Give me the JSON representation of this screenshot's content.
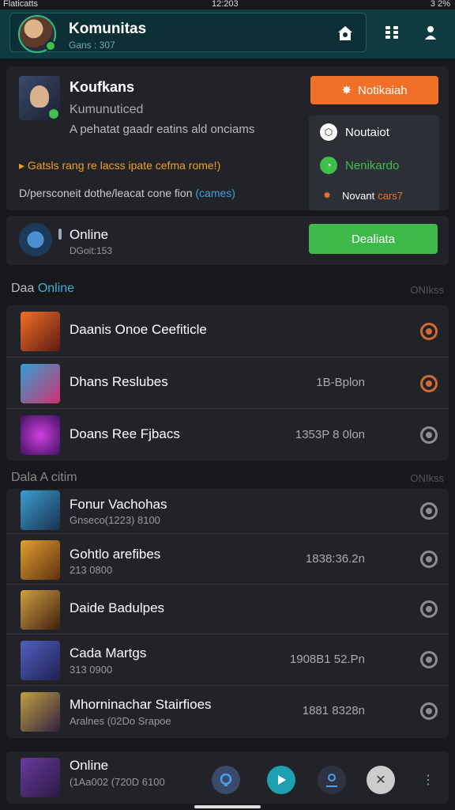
{
  "status_bar": {
    "carrier": "Flaticatts",
    "time": "12:203",
    "battery": "3 2%"
  },
  "header": {
    "title": "Komunitas",
    "subtitle": "Gans : 307"
  },
  "notification": {
    "title": "Koufkans",
    "subtitle": "Kumunuticed",
    "description": "A pehatat gaadr eatins ald onciams",
    "highlight_line": "Gatsls rang re lacss ipate cefma rome!)",
    "info_line": "D/persconeit dothe/leacat cone fion",
    "info_link": "(cames)",
    "action_button": "Notikaiah",
    "menu": [
      {
        "label": "Noutaiot",
        "icon": "hexagon-icon",
        "color": "#ffffff"
      },
      {
        "label": "Nenikardo",
        "icon": "chat-icon",
        "color": "#3fbf4a"
      },
      {
        "label": "Novant",
        "label_accent": "cars7",
        "icon": "spark-icon",
        "color": "#f07028"
      }
    ]
  },
  "online_card": {
    "title": "Online",
    "subtitle": "DGoit:153",
    "button": "Dealiata"
  },
  "section1": {
    "title_prefix": "Daa",
    "title_highlight": "Online",
    "right_label": "ONIkss",
    "rows": [
      {
        "title": "Daanis Onoe Ceefiticle",
        "meta": "",
        "gear": "orange"
      },
      {
        "title": "Dhans Reslubes",
        "meta": "1B-Bplon",
        "gear": "orange"
      },
      {
        "title": "Doans Ree Fjbacs",
        "meta": "1353P 8 0lon",
        "gear": "gray"
      }
    ]
  },
  "section2": {
    "title": "Dala A citim",
    "right_label": "ONIkss",
    "rows": [
      {
        "title": "Fonur Vachohas",
        "sub": "Gnseco(1223) 8100",
        "meta": "",
        "gear": "gray"
      },
      {
        "title": "Gohtlo arefibes",
        "sub": "213 0800",
        "meta": "1838:36.2n",
        "gear": "gray"
      },
      {
        "title": "Daide Badulpes",
        "sub": "",
        "meta": "",
        "gear": "gray"
      },
      {
        "title": "Cada Martgs",
        "sub": "313 0900",
        "meta": "1908B1 52.Pn",
        "gear": "gray"
      },
      {
        "title": "Mhorninachar Stairfioes",
        "sub": "Aralnes (02Do Srapoe",
        "meta": "1881 8328n",
        "gear": "gray"
      }
    ]
  },
  "bottom_card": {
    "title": "Online",
    "subtitle": "(1Aa002 (720D 6100"
  },
  "colors": {
    "accent_orange": "#f07028",
    "accent_green": "#3dba4a",
    "accent_teal": "#0f3a40",
    "link_blue": "#3fa0e0"
  }
}
